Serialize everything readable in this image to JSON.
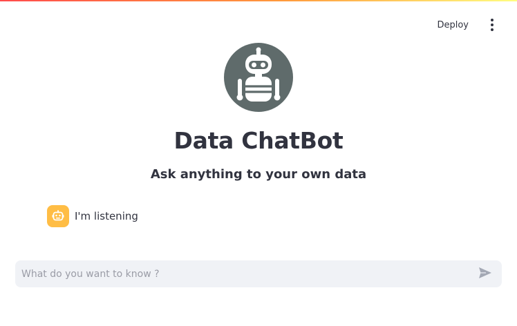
{
  "toolbar": {
    "deploy_label": "Deploy",
    "menu_icon": "more-vertical-icon"
  },
  "header": {
    "logo_icon": "robot-icon",
    "title": "Data ChatBot",
    "subtitle": "Ask anything to your own data"
  },
  "chat": {
    "messages": [
      {
        "role": "assistant",
        "avatar_icon": "bot-icon",
        "text": "I'm listening"
      }
    ],
    "input": {
      "placeholder": "What do you want to know ?",
      "value": "",
      "send_icon": "send-icon"
    }
  },
  "colors": {
    "logo_circle": "#5f6b6b",
    "avatar_bg": "#ffbd45",
    "input_bg": "#f0f2f6",
    "text": "#31333f"
  }
}
